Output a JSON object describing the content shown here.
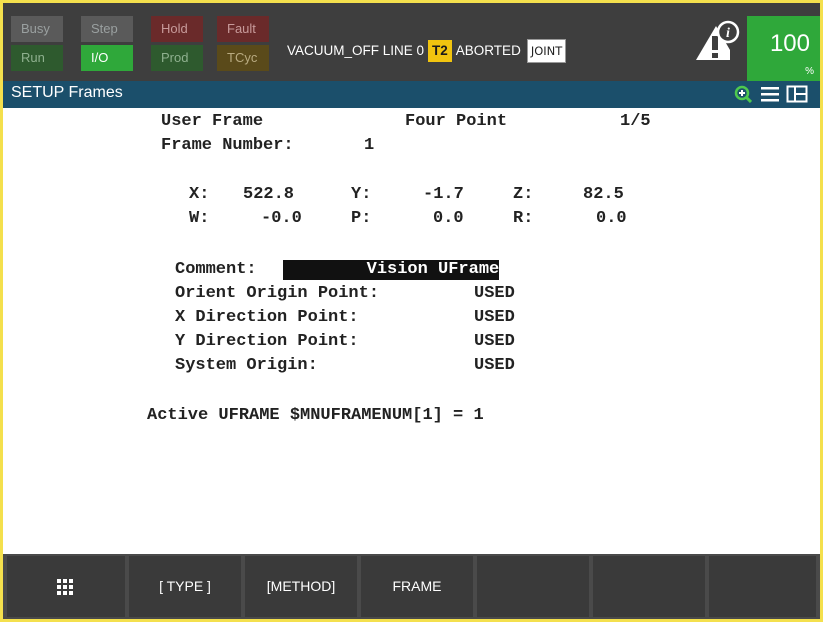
{
  "status": {
    "leds": {
      "busy": "Busy",
      "step": "Step",
      "hold": "Hold",
      "fault": "Fault",
      "run": "Run",
      "io": "I/O",
      "prod": "Prod",
      "tcyc": "TCyc"
    },
    "message_prefix": "VACUUM_OFF LINE 0",
    "mode": "T2",
    "state": "ABORTED",
    "coord": "JOINT",
    "override_value": "100",
    "override_unit": "%"
  },
  "titlebar": {
    "title": "SETUP Frames"
  },
  "frame": {
    "type_label": "User Frame",
    "method": "Four Point",
    "page": "1/5",
    "number_label": "Frame Number:",
    "number": "1",
    "coords": {
      "x_label": "X:",
      "x": "522.8",
      "y_label": "Y:",
      "y": "-1.7",
      "z_label": "Z:",
      "z": "82.5",
      "w_label": "W:",
      "w": "-0.0",
      "p_label": "P:",
      "p": "0.0",
      "r_label": "R:",
      "r": "0.0"
    },
    "comment_label": "Comment:",
    "comment_value": "        Vision UFrame",
    "points": [
      {
        "label": "Orient Origin Point:",
        "value": "USED"
      },
      {
        "label": "X Direction Point:",
        "value": "USED"
      },
      {
        "label": "Y Direction Point:",
        "value": "USED"
      },
      {
        "label": "System Origin:",
        "value": "USED"
      }
    ],
    "active_line": "Active UFRAME $MNUFRAMENUM[1] = 1"
  },
  "softkeys": {
    "f1": "[ TYPE ]",
    "f2": "[METHOD]",
    "f3": "FRAME",
    "f4": "",
    "f5": "",
    "f6": ""
  },
  "colors": {
    "frame_border": "#f4e04d",
    "status_green": "#2fa83a",
    "titlebar": "#1b4f6b",
    "badge_yellow": "#f1c40f"
  },
  "icons": {
    "alert": "alert-info-icon",
    "zoom": "zoom-in-icon",
    "menu": "hamburger-menu-icon",
    "layout": "window-split-icon",
    "grid": "grid-menu-icon"
  }
}
